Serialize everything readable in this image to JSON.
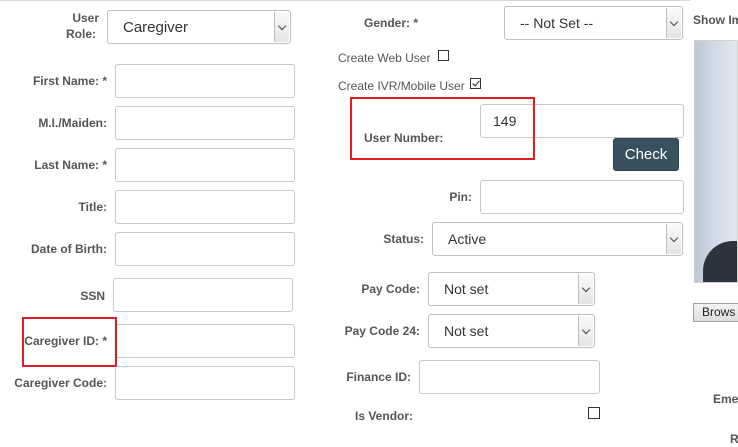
{
  "left": {
    "user_role_label_1": "User",
    "user_role_label_2": "Role:",
    "user_role_value": "Caregiver",
    "first_name_label": "First Name: *",
    "mi_label": "M.I./Maiden:",
    "last_name_label": "Last Name: *",
    "title_label": "Title:",
    "dob_label": "Date of Birth:",
    "ssn_label": "SSN",
    "caregiver_id_label": "Caregiver ID: *",
    "caregiver_code_label": "Caregiver Code:"
  },
  "middle": {
    "gender_label": "Gender: *",
    "gender_value": "-- Not Set --",
    "create_web_user_label": "Create Web User",
    "create_web_user_checked": false,
    "create_ivr_label": "Create IVR/Mobile User",
    "create_ivr_checked": true,
    "user_number_label": "User Number:",
    "user_number_value": "149",
    "check_button": "Check",
    "pin_label": "Pin:",
    "status_label": "Status:",
    "status_value": "Active",
    "pay_code_label": "Pay Code:",
    "pay_code_value": "Not set",
    "pay_code_24_label": "Pay Code 24:",
    "pay_code_24_value": "Not set",
    "finance_id_label": "Finance ID:",
    "is_vendor_label": "Is Vendor:",
    "is_vendor_checked": false
  },
  "right": {
    "show_image_label": "Show Im",
    "browse_button": "Brows",
    "emergency_label_fragment": "Eme",
    "bottom_fragment": "R"
  },
  "colors": {
    "highlight": "#e11b22",
    "check_button_bg": "#39505f"
  }
}
